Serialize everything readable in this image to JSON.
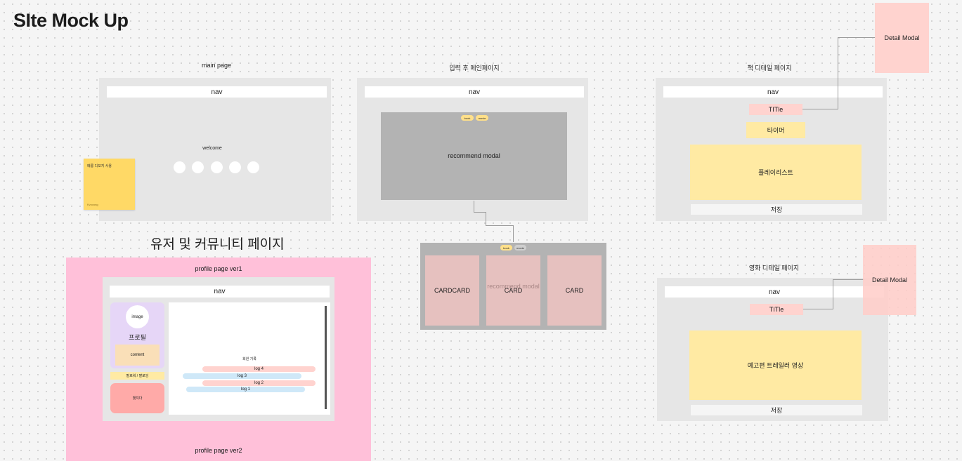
{
  "title": "SIte Mock Up",
  "main_page": {
    "label": "main page",
    "nav": "nav",
    "welcome": "welcome",
    "sticky_note": {
      "text": "메롱 디모지 사용",
      "author": "Kvovong"
    }
  },
  "input_main": {
    "label": "입력 후 메인페이지",
    "nav": "nav",
    "modal": "recommend modal",
    "pills": [
      "book",
      "movie"
    ]
  },
  "book_detail": {
    "label": "책 디테일 페이지",
    "nav": "nav",
    "title_box": "TITle",
    "timer": "타이머",
    "playlist": "플레이리스트",
    "save": "저장"
  },
  "detail_modal_top": "Detail Modal",
  "detail_modal_bottom": "Detail Modal",
  "user_section_title": "유저 및 커뮤니티 페이지",
  "profile": {
    "label_v1": "profile page ver1",
    "label_v2": "profile page ver2",
    "nav": "nav",
    "image": "image",
    "profile_label": "프로필",
    "content": "content",
    "follow": "팔로워 / 팔로잉",
    "badge": "뱃지다",
    "record_title": "회원 기록",
    "logs": [
      "log 4",
      "log 3",
      "log 2",
      "log 1"
    ]
  },
  "cards": {
    "pills": [
      "book",
      "movie"
    ],
    "items": [
      "CARDCARD",
      "CARD",
      "CARD"
    ],
    "ghost": "recommend modal"
  },
  "movie_detail": {
    "label": "영화 디테일 페이지",
    "nav": "nav",
    "title_box": "TITle",
    "trailer": "예고편 트레일러 영상",
    "save": "저장"
  },
  "colors": {
    "frame": "#e6e6e6",
    "modal_gray": "#b3b3b3",
    "salmon": "#ffd3cf",
    "yellow": "#ffeaa3",
    "pink": "#ffc0d9",
    "lavender": "#e6d6f7",
    "card": "#e6c1bf"
  }
}
